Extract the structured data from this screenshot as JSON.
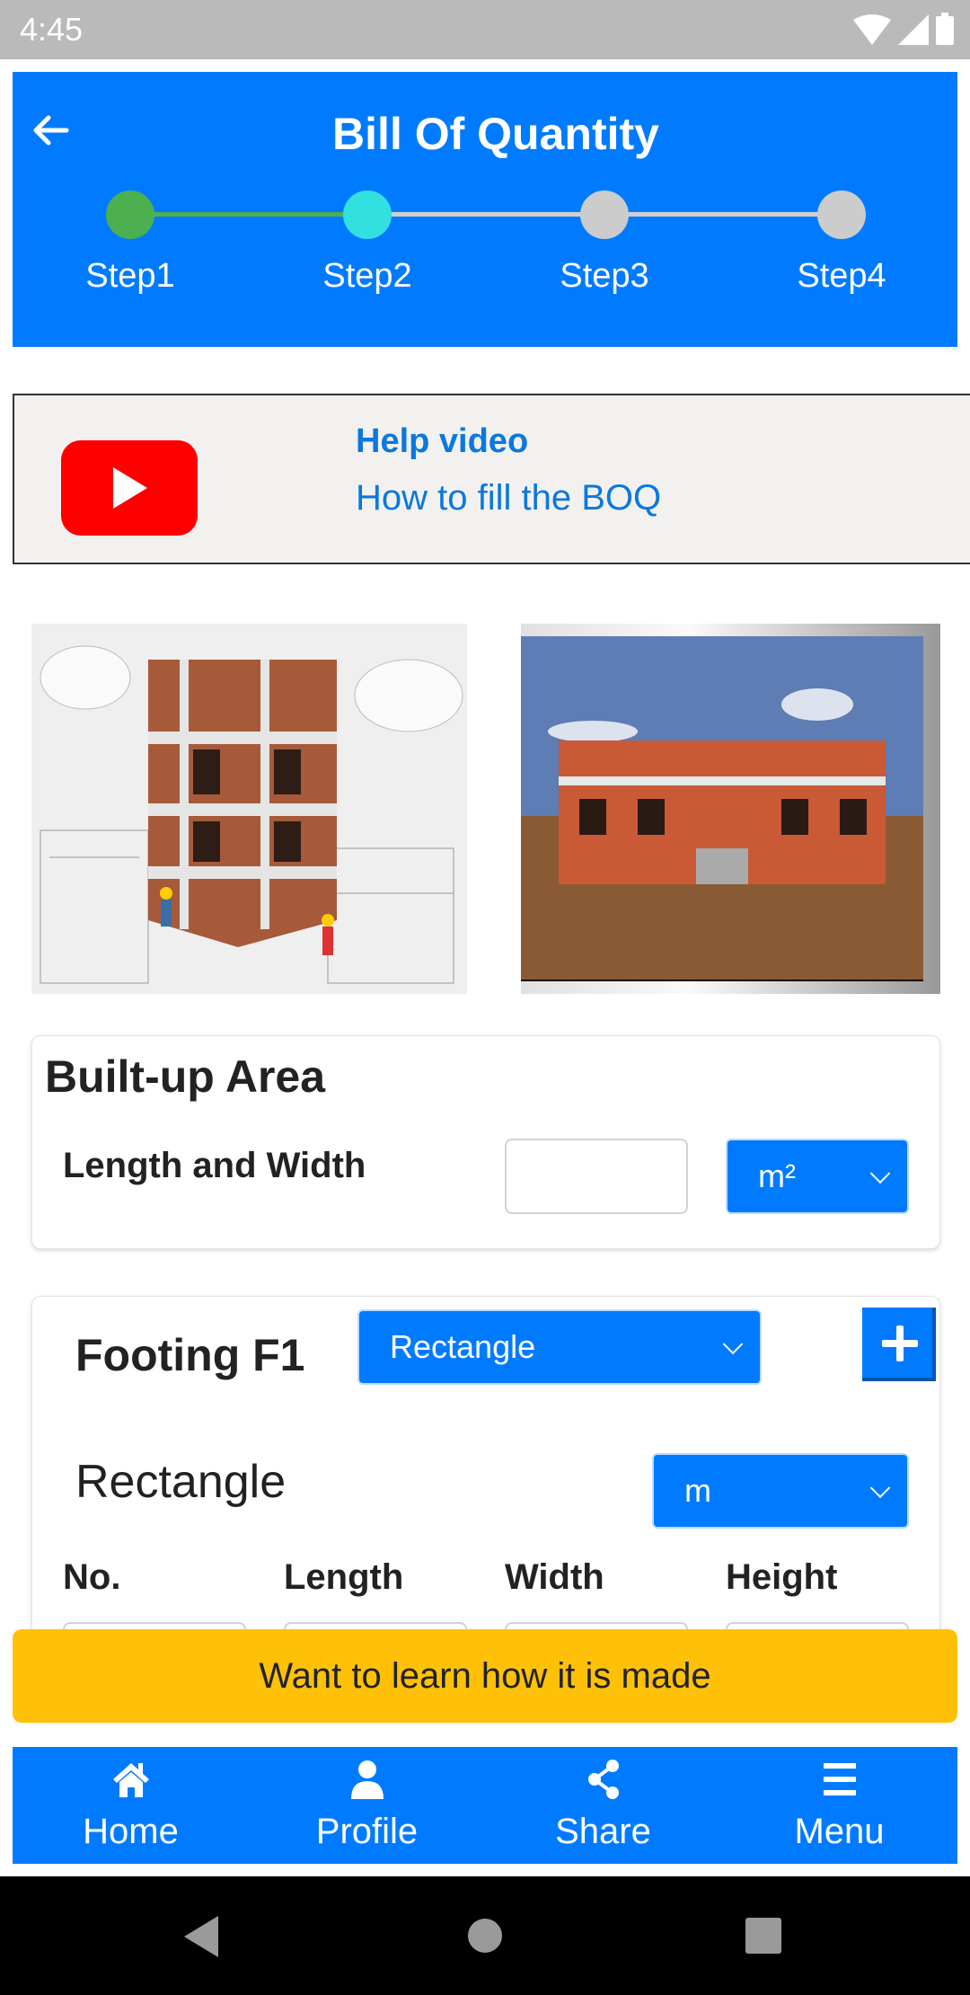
{
  "status_bar": {
    "time": "4:45",
    "icons": [
      "wifi-icon",
      "signal-icon",
      "battery-icon"
    ]
  },
  "header": {
    "title": "Bill Of Quantity",
    "back_icon": "arrow-left-icon",
    "steps": [
      {
        "label": "Step1",
        "state": "completed",
        "color": "#4caf50"
      },
      {
        "label": "Step2",
        "state": "current",
        "color": "#33e0e0"
      },
      {
        "label": "Step3",
        "state": "pending",
        "color": "#cccccc"
      },
      {
        "label": "Step4",
        "state": "pending",
        "color": "#cccccc"
      }
    ]
  },
  "help": {
    "icon": "youtube-play-icon",
    "title": "Help video",
    "subtitle": "How to fill the BOQ"
  },
  "images": [
    {
      "alt": "Multi-storey brick building under construction with workers on blueprints"
    },
    {
      "alt": "Rendered single-storey brick house front view"
    }
  ],
  "built_up_area": {
    "title": "Built-up Area",
    "label": "Length and Width",
    "value": "",
    "unit": "m²"
  },
  "footing": {
    "title": "Footing F1",
    "shape_selected": "Rectangle",
    "add_icon": "plus-icon",
    "shape_heading": "Rectangle",
    "unit": "m",
    "columns": [
      "No.",
      "Length",
      "Width",
      "Height"
    ]
  },
  "learn_button": "Want to learn how it is made",
  "bottom_nav": [
    {
      "label": "Home",
      "icon": "home-icon"
    },
    {
      "label": "Profile",
      "icon": "user-icon"
    },
    {
      "label": "Share",
      "icon": "share-icon"
    },
    {
      "label": "Menu",
      "icon": "menu-icon"
    }
  ],
  "colors": {
    "primary": "#007bff",
    "accent_yellow": "#ffc107",
    "youtube_red": "#ff0000"
  }
}
